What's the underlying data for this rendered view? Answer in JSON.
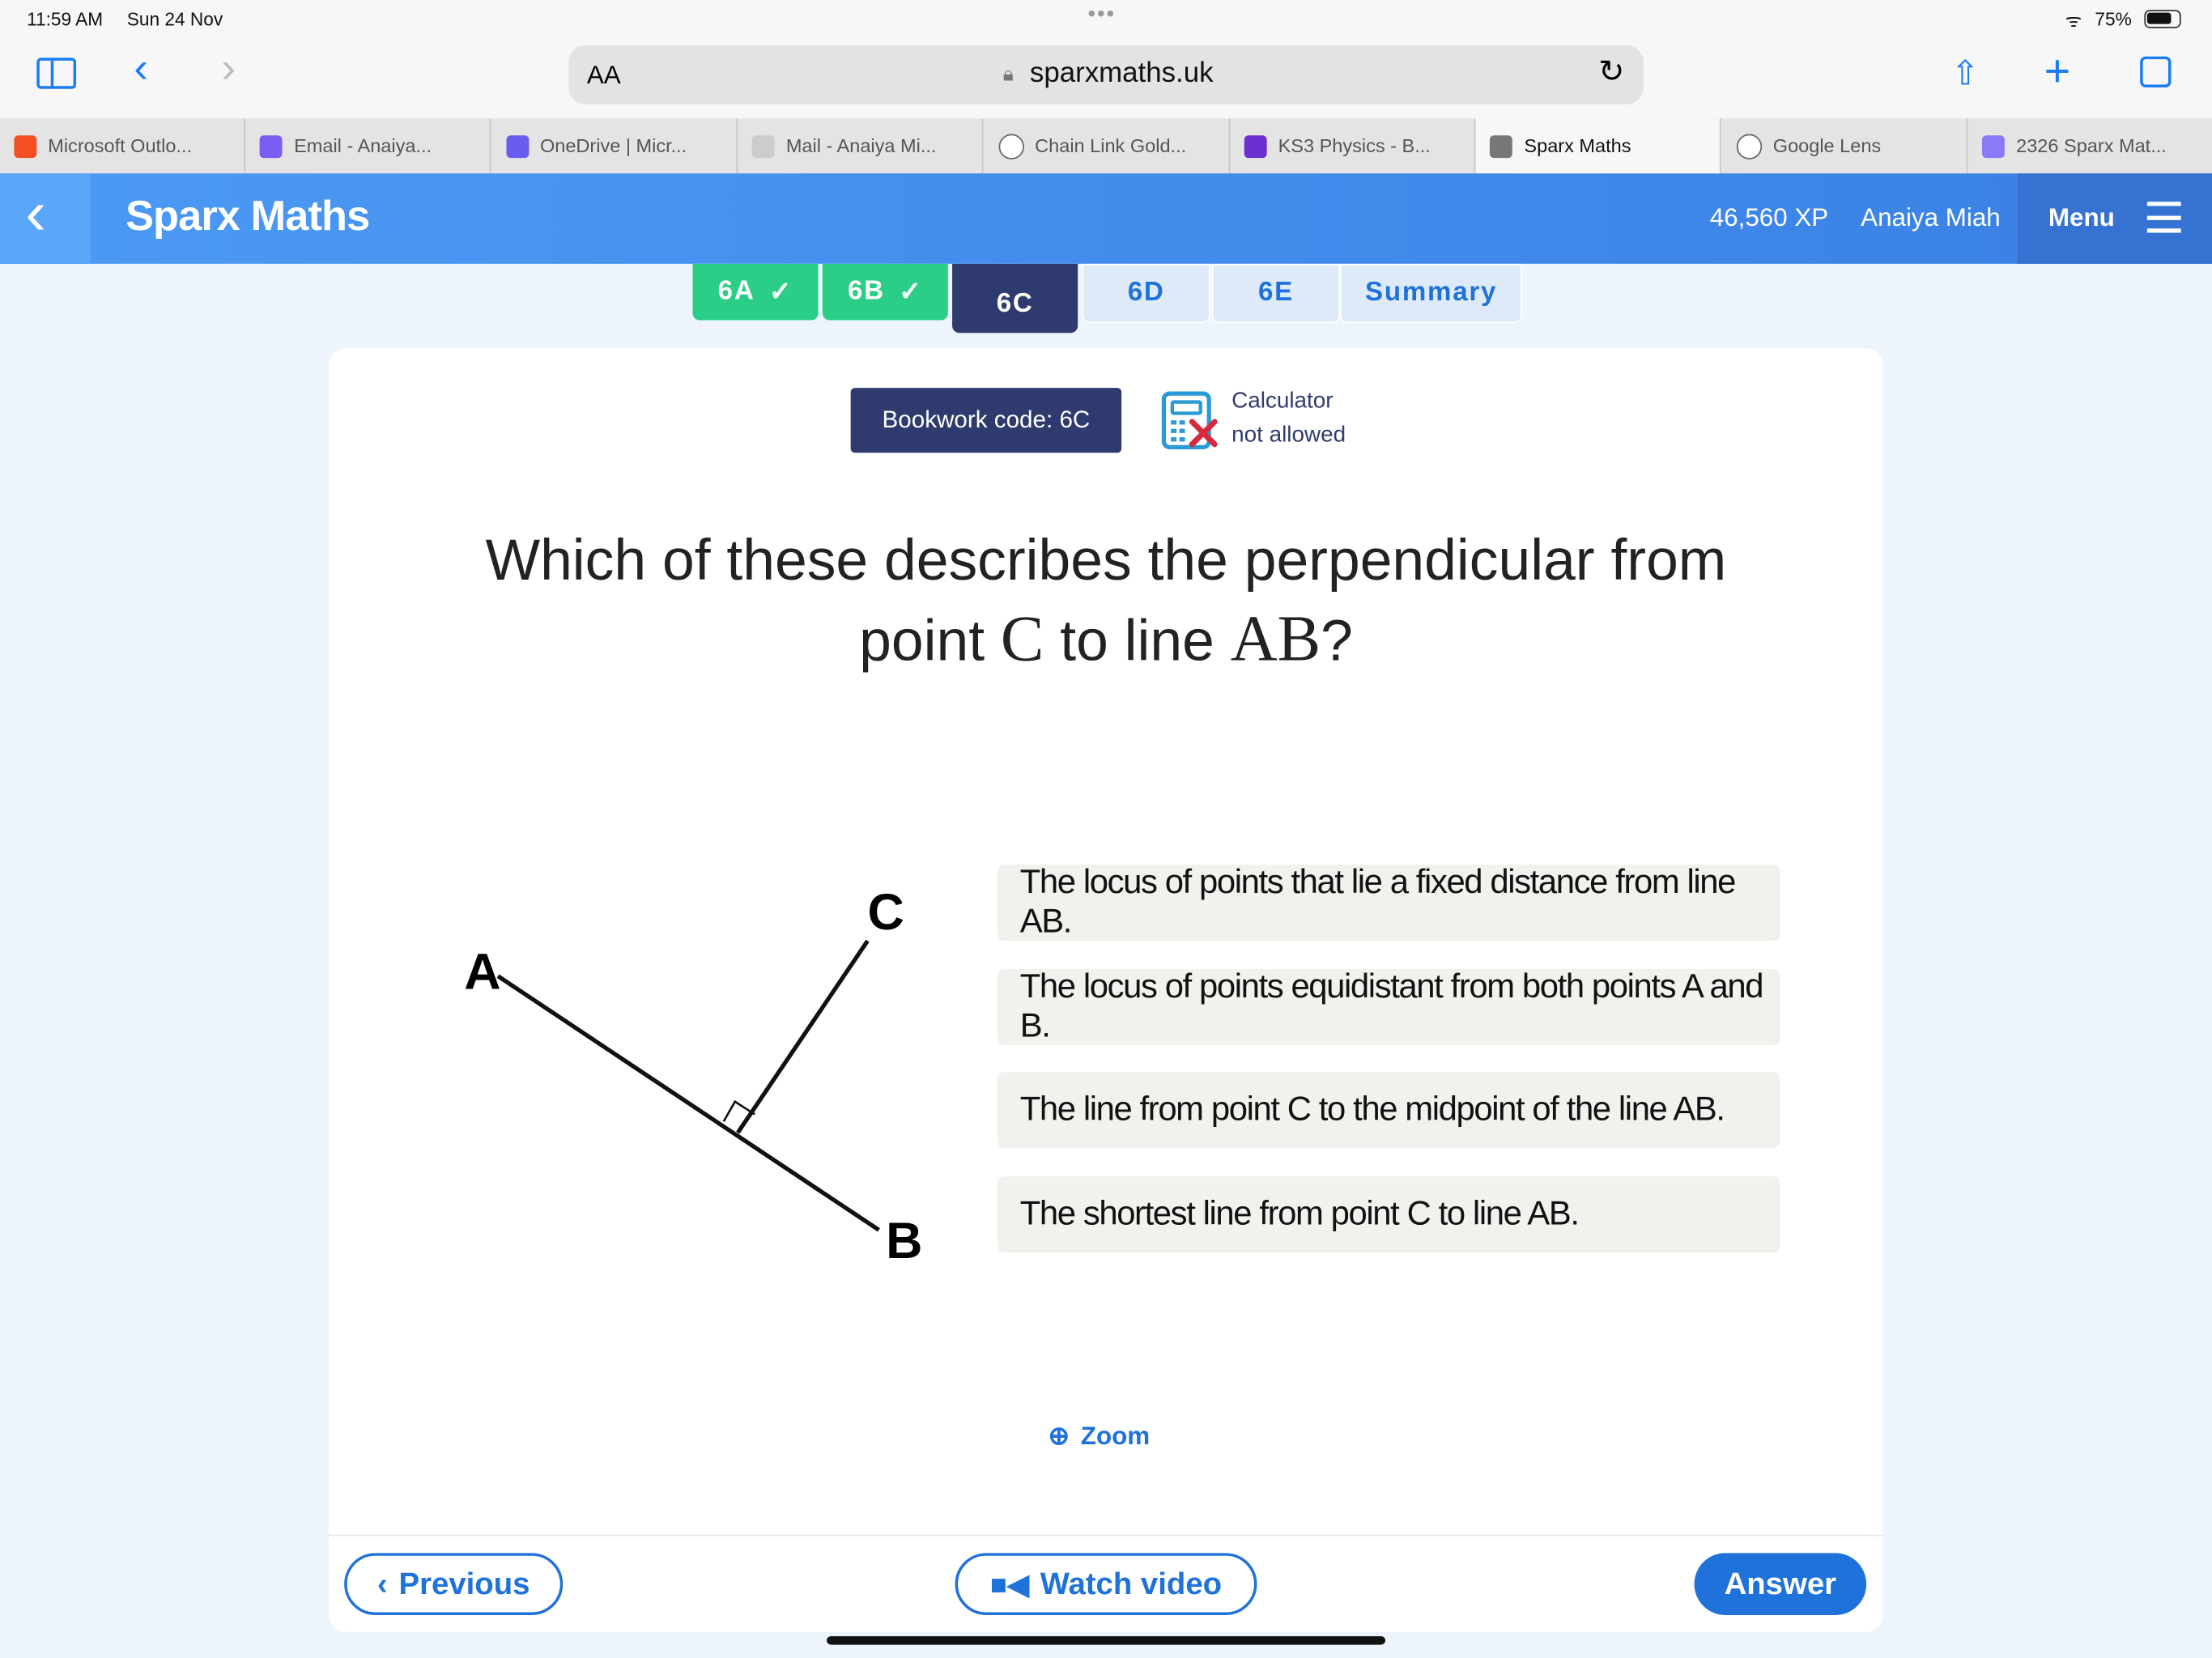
{
  "status_bar": {
    "time": "11:59 AM",
    "date": "Sun 24 Nov",
    "battery": "75%",
    "battery_level": 0.75
  },
  "browser": {
    "text_size_label": "AA",
    "url": "sparxmaths.uk",
    "tabs": [
      {
        "label": "Microsoft Outlo...",
        "active": false
      },
      {
        "label": "Email - Anaiya...",
        "active": false
      },
      {
        "label": "OneDrive | Micr...",
        "active": false
      },
      {
        "label": "Mail - Anaiya Mi...",
        "active": false
      },
      {
        "label": "Chain Link Gold...",
        "active": false
      },
      {
        "label": "KS3 Physics - B...",
        "active": false
      },
      {
        "label": "Sparx Maths",
        "active": true
      },
      {
        "label": "Google Lens",
        "active": false
      },
      {
        "label": "2326 Sparx Mat...",
        "active": false
      }
    ]
  },
  "header": {
    "title": "Sparx Maths",
    "xp": "46,560 XP",
    "user": "Anaiya Miah",
    "menu": "Menu"
  },
  "question_tabs": [
    {
      "label": "6A",
      "state": "complete"
    },
    {
      "label": "6B",
      "state": "complete"
    },
    {
      "label": "6C",
      "state": "current"
    },
    {
      "label": "6D",
      "state": "pending"
    },
    {
      "label": "6E",
      "state": "pending"
    },
    {
      "label": "Summary",
      "state": "pending"
    }
  ],
  "question": {
    "bookwork_code": "Bookwork code: 6C",
    "calculator_line1": "Calculator",
    "calculator_line2": "not allowed",
    "text_line1": "Which of these describes the perpendicular from",
    "text_line2_pre": "point ",
    "point": "C",
    "text_line2_mid": " to line ",
    "line": "AB",
    "text_line2_post": "?",
    "diagram_labels": {
      "a": "A",
      "b": "B",
      "c": "C"
    },
    "options": [
      "The locus of points that lie a fixed distance from line AB.",
      "The locus of points equidistant from both points A and B.",
      "The line from point C to the midpoint of the line AB.",
      "The shortest line from point C to line AB."
    ],
    "zoom": "Zoom"
  },
  "footer": {
    "previous": "Previous",
    "watch_video": "Watch video",
    "answer": "Answer"
  },
  "colors": {
    "header_blue": "#4290ee",
    "tab_complete": "#2ace86",
    "tab_current": "#2f3b6e",
    "accent": "#1f72d9"
  }
}
